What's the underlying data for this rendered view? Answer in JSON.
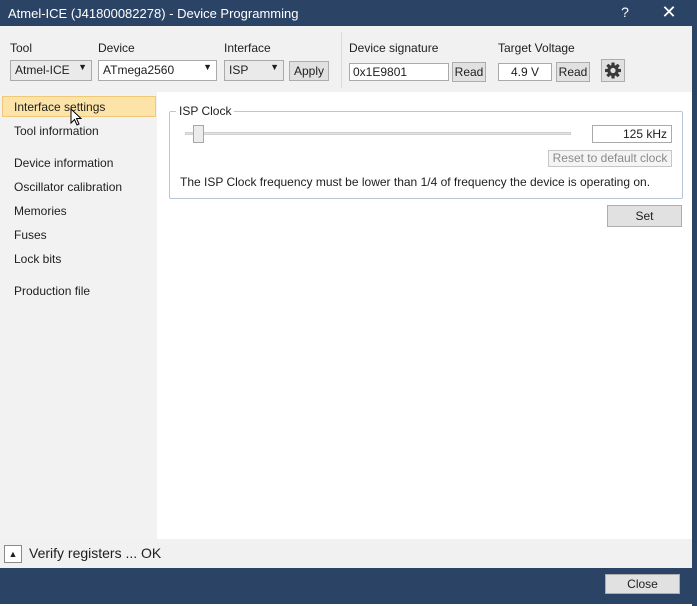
{
  "window": {
    "title": "Atmel-ICE (J41800082278) - Device Programming",
    "help_label": "?",
    "close_label": "✕"
  },
  "toolbar": {
    "tool_label": "Tool",
    "tool_value": "Atmel-ICE",
    "device_label": "Device",
    "device_value": "ATmega2560",
    "interface_label": "Interface",
    "interface_value": "ISP",
    "apply_label": "Apply",
    "signature_label": "Device signature",
    "signature_value": "0x1E9801",
    "signature_read_label": "Read",
    "voltage_label": "Target Voltage",
    "voltage_value": "4.9 V",
    "voltage_read_label": "Read",
    "settings_icon": "gear-icon"
  },
  "sidebar": {
    "items": [
      {
        "label": "Interface settings",
        "selected": true
      },
      {
        "label": "Tool information",
        "selected": false
      },
      {
        "label": "Device information",
        "selected": false
      },
      {
        "label": "Oscillator calibration",
        "selected": false
      },
      {
        "label": "Memories",
        "selected": false
      },
      {
        "label": "Fuses",
        "selected": false
      },
      {
        "label": "Lock bits",
        "selected": false
      },
      {
        "label": "Production file",
        "selected": false
      }
    ]
  },
  "isp": {
    "group_label": "ISP Clock",
    "clock_value": "125 kHz",
    "slider_position": 0.02,
    "reset_label": "Reset to default clock",
    "note": "The ISP Clock frequency must be lower than 1/4 of frequency the device is operating on.",
    "set_label": "Set"
  },
  "status": {
    "expand_icon": "triangle-up-icon",
    "text": "Verify registers ... OK"
  },
  "footer": {
    "close_label": "Close"
  },
  "colors": {
    "titlebar": "#2b4465",
    "selected_item": "#fce4a8"
  }
}
